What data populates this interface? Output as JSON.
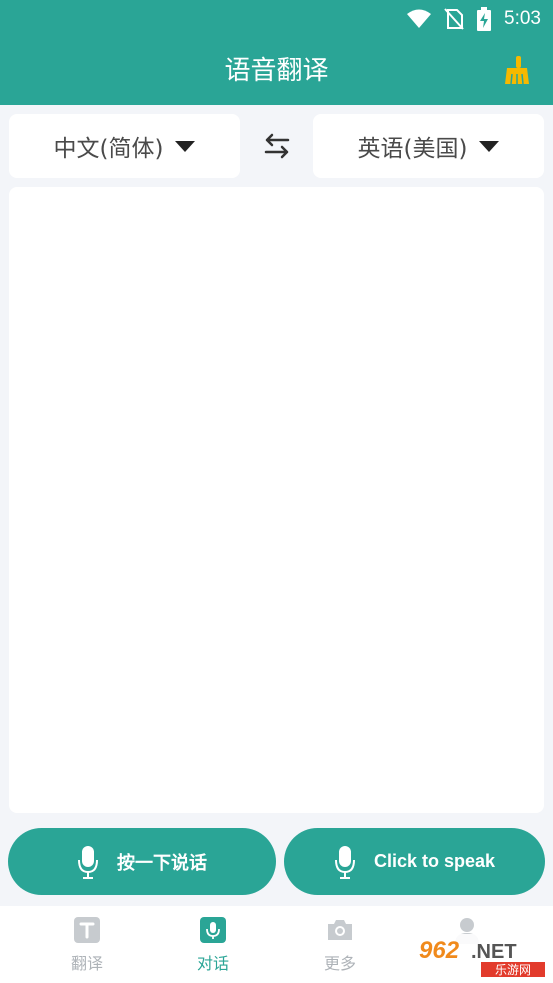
{
  "status_bar": {
    "time": "5:03"
  },
  "header": {
    "title": "语音翻译"
  },
  "source_lang": {
    "label": "中文(简体)"
  },
  "target_lang": {
    "label": "英语(美国)"
  },
  "speak_buttons": {
    "left_label": "按一下说话",
    "right_label": "Click to speak"
  },
  "tabs": [
    {
      "label": "翻译",
      "icon": "text-t-icon",
      "active": false
    },
    {
      "label": "对话",
      "icon": "microphone-icon",
      "active": true
    },
    {
      "label": "更多",
      "icon": "camera-icon",
      "active": false
    },
    {
      "label": "",
      "icon": "user-icon",
      "active": false
    }
  ],
  "watermark": {
    "text": "962.NET",
    "subtext": "乐游网"
  },
  "colors": {
    "primary": "#2aa596",
    "accent": "#f5b900",
    "background": "#f3f5f9"
  }
}
